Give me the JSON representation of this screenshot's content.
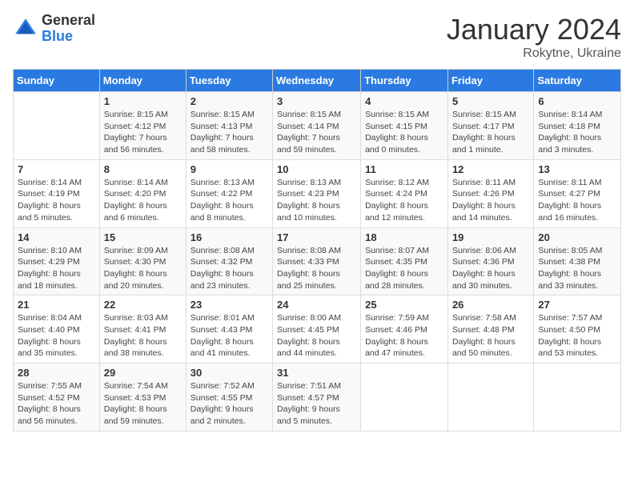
{
  "header": {
    "logo_general": "General",
    "logo_blue": "Blue",
    "month_title": "January 2024",
    "location": "Rokytne, Ukraine"
  },
  "days_of_week": [
    "Sunday",
    "Monday",
    "Tuesday",
    "Wednesday",
    "Thursday",
    "Friday",
    "Saturday"
  ],
  "weeks": [
    [
      {
        "day": "",
        "info": ""
      },
      {
        "day": "1",
        "info": "Sunrise: 8:15 AM\nSunset: 4:12 PM\nDaylight: 7 hours\nand 56 minutes."
      },
      {
        "day": "2",
        "info": "Sunrise: 8:15 AM\nSunset: 4:13 PM\nDaylight: 7 hours\nand 58 minutes."
      },
      {
        "day": "3",
        "info": "Sunrise: 8:15 AM\nSunset: 4:14 PM\nDaylight: 7 hours\nand 59 minutes."
      },
      {
        "day": "4",
        "info": "Sunrise: 8:15 AM\nSunset: 4:15 PM\nDaylight: 8 hours\nand 0 minutes."
      },
      {
        "day": "5",
        "info": "Sunrise: 8:15 AM\nSunset: 4:17 PM\nDaylight: 8 hours\nand 1 minute."
      },
      {
        "day": "6",
        "info": "Sunrise: 8:14 AM\nSunset: 4:18 PM\nDaylight: 8 hours\nand 3 minutes."
      }
    ],
    [
      {
        "day": "7",
        "info": "Sunrise: 8:14 AM\nSunset: 4:19 PM\nDaylight: 8 hours\nand 5 minutes."
      },
      {
        "day": "8",
        "info": "Sunrise: 8:14 AM\nSunset: 4:20 PM\nDaylight: 8 hours\nand 6 minutes."
      },
      {
        "day": "9",
        "info": "Sunrise: 8:13 AM\nSunset: 4:22 PM\nDaylight: 8 hours\nand 8 minutes."
      },
      {
        "day": "10",
        "info": "Sunrise: 8:13 AM\nSunset: 4:23 PM\nDaylight: 8 hours\nand 10 minutes."
      },
      {
        "day": "11",
        "info": "Sunrise: 8:12 AM\nSunset: 4:24 PM\nDaylight: 8 hours\nand 12 minutes."
      },
      {
        "day": "12",
        "info": "Sunrise: 8:11 AM\nSunset: 4:26 PM\nDaylight: 8 hours\nand 14 minutes."
      },
      {
        "day": "13",
        "info": "Sunrise: 8:11 AM\nSunset: 4:27 PM\nDaylight: 8 hours\nand 16 minutes."
      }
    ],
    [
      {
        "day": "14",
        "info": "Sunrise: 8:10 AM\nSunset: 4:29 PM\nDaylight: 8 hours\nand 18 minutes."
      },
      {
        "day": "15",
        "info": "Sunrise: 8:09 AM\nSunset: 4:30 PM\nDaylight: 8 hours\nand 20 minutes."
      },
      {
        "day": "16",
        "info": "Sunrise: 8:08 AM\nSunset: 4:32 PM\nDaylight: 8 hours\nand 23 minutes."
      },
      {
        "day": "17",
        "info": "Sunrise: 8:08 AM\nSunset: 4:33 PM\nDaylight: 8 hours\nand 25 minutes."
      },
      {
        "day": "18",
        "info": "Sunrise: 8:07 AM\nSunset: 4:35 PM\nDaylight: 8 hours\nand 28 minutes."
      },
      {
        "day": "19",
        "info": "Sunrise: 8:06 AM\nSunset: 4:36 PM\nDaylight: 8 hours\nand 30 minutes."
      },
      {
        "day": "20",
        "info": "Sunrise: 8:05 AM\nSunset: 4:38 PM\nDaylight: 8 hours\nand 33 minutes."
      }
    ],
    [
      {
        "day": "21",
        "info": "Sunrise: 8:04 AM\nSunset: 4:40 PM\nDaylight: 8 hours\nand 35 minutes."
      },
      {
        "day": "22",
        "info": "Sunrise: 8:03 AM\nSunset: 4:41 PM\nDaylight: 8 hours\nand 38 minutes."
      },
      {
        "day": "23",
        "info": "Sunrise: 8:01 AM\nSunset: 4:43 PM\nDaylight: 8 hours\nand 41 minutes."
      },
      {
        "day": "24",
        "info": "Sunrise: 8:00 AM\nSunset: 4:45 PM\nDaylight: 8 hours\nand 44 minutes."
      },
      {
        "day": "25",
        "info": "Sunrise: 7:59 AM\nSunset: 4:46 PM\nDaylight: 8 hours\nand 47 minutes."
      },
      {
        "day": "26",
        "info": "Sunrise: 7:58 AM\nSunset: 4:48 PM\nDaylight: 8 hours\nand 50 minutes."
      },
      {
        "day": "27",
        "info": "Sunrise: 7:57 AM\nSunset: 4:50 PM\nDaylight: 8 hours\nand 53 minutes."
      }
    ],
    [
      {
        "day": "28",
        "info": "Sunrise: 7:55 AM\nSunset: 4:52 PM\nDaylight: 8 hours\nand 56 minutes."
      },
      {
        "day": "29",
        "info": "Sunrise: 7:54 AM\nSunset: 4:53 PM\nDaylight: 8 hours\nand 59 minutes."
      },
      {
        "day": "30",
        "info": "Sunrise: 7:52 AM\nSunset: 4:55 PM\nDaylight: 9 hours\nand 2 minutes."
      },
      {
        "day": "31",
        "info": "Sunrise: 7:51 AM\nSunset: 4:57 PM\nDaylight: 9 hours\nand 5 minutes."
      },
      {
        "day": "",
        "info": ""
      },
      {
        "day": "",
        "info": ""
      },
      {
        "day": "",
        "info": ""
      }
    ]
  ]
}
